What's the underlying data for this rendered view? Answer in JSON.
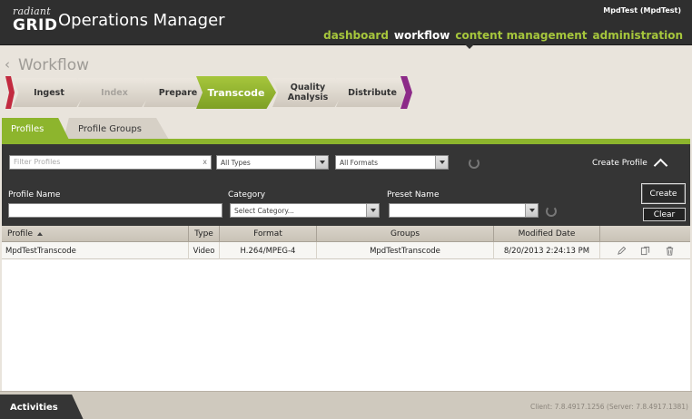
{
  "header": {
    "logo_top": "radiant",
    "logo_bottom": "GRID",
    "app_title": "Operations Manager",
    "user": "MpdTest (MpdTest)",
    "nav": [
      {
        "label": "dashboard",
        "active": false
      },
      {
        "label": "workflow",
        "active": true
      },
      {
        "label": "content management",
        "active": false
      },
      {
        "label": "administration",
        "active": false
      }
    ]
  },
  "workflow": {
    "title": "Workflow",
    "steps": [
      {
        "label": "Ingest",
        "state": "normal"
      },
      {
        "label": "Index",
        "state": "disabled"
      },
      {
        "label": "Prepare",
        "state": "normal"
      },
      {
        "label": "Transcode",
        "state": "active"
      },
      {
        "label": "Quality Analysis",
        "state": "normal"
      },
      {
        "label": "Distribute",
        "state": "normal"
      }
    ]
  },
  "tabs": {
    "profiles": "Profiles",
    "profile_groups": "Profile Groups"
  },
  "filters": {
    "filter_placeholder": "Filter Profiles",
    "clear_glyph": "x",
    "types_value": "All Types",
    "formats_value": "All Formats",
    "create_profile_label": "Create Profile"
  },
  "create_form": {
    "profile_name_label": "Profile Name",
    "category_label": "Category",
    "category_value": "Select Category...",
    "preset_name_label": "Preset Name",
    "create_button": "Create",
    "clear_button": "Clear"
  },
  "table": {
    "headers": {
      "profile": "Profile",
      "type": "Type",
      "format": "Format",
      "groups": "Groups",
      "modified": "Modified Date"
    },
    "rows": [
      {
        "profile": "MpdTestTranscode",
        "type": "Video",
        "format": "H.264/MPEG-4",
        "groups": "MpdTestTranscode",
        "modified": "8/20/2013 2:24:13 PM"
      }
    ]
  },
  "footer": {
    "activities": "Activities",
    "version": "Client: 7.8.4917.1256 (Server: 7.8.4917.1381)"
  },
  "colors": {
    "accent_green": "#8db52d",
    "header_dark": "#2f2f2f",
    "nav_green": "#a6c63c",
    "step_left_edge": "#c22a3f",
    "step_right_edge": "#8c2a88"
  },
  "icons": [
    "back-chevron-icon",
    "refresh-icon",
    "collapse-chevron-icon",
    "sort-ascending-icon",
    "edit-pencil-icon",
    "copy-icon",
    "delete-trash-icon",
    "dropdown-arrow-icon"
  ]
}
